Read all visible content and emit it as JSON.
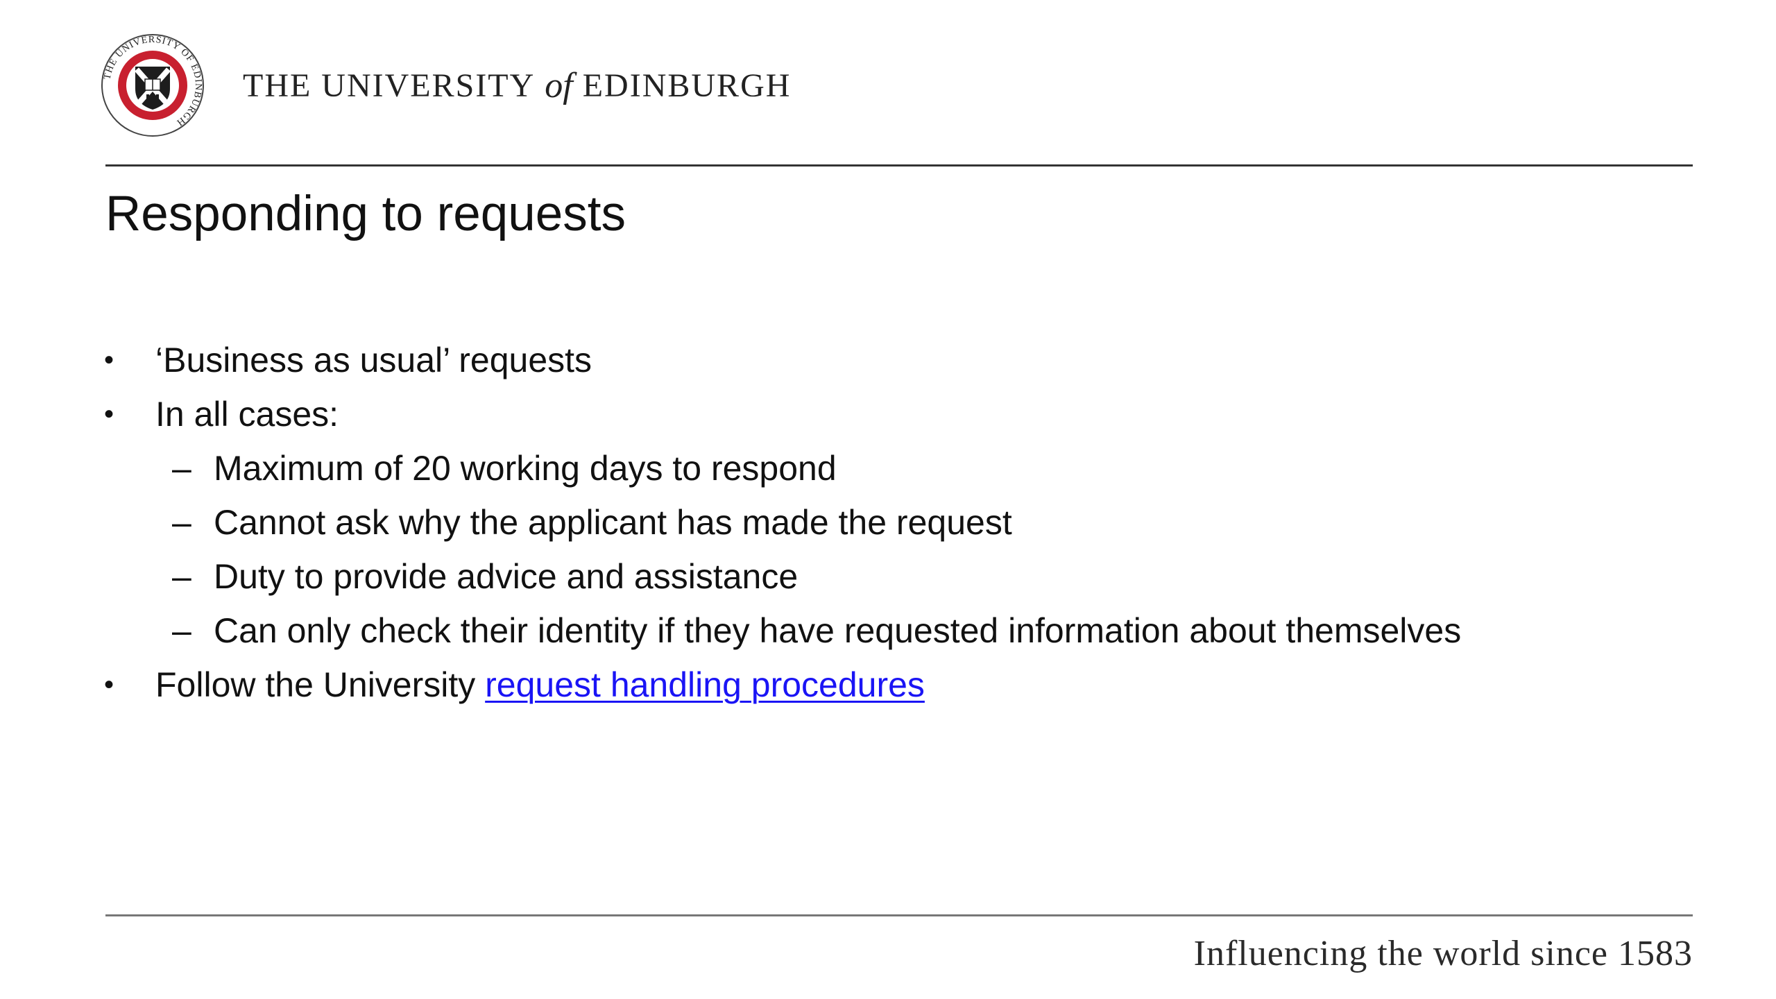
{
  "header": {
    "university_name_part1": "THE UNIVERSITY",
    "university_name_of": "of",
    "university_name_part2": "EDINBURGH",
    "crest_ring_text": "THE UNIVERSITY OF EDINBURGH"
  },
  "slide": {
    "title": "Responding to requests",
    "bullets": [
      {
        "marker": "•",
        "text": "‘Business as usual’ requests"
      },
      {
        "marker": "•",
        "text": "In all cases:"
      },
      {
        "marker": "–",
        "text": "Maximum of 20 working days to respond"
      },
      {
        "marker": "–",
        "text": "Cannot ask why the applicant has made the request"
      },
      {
        "marker": "–",
        "text": "Duty to provide advice and assistance"
      },
      {
        "marker": "–",
        "text": "Can only check their identity if they have requested information about themselves"
      },
      {
        "marker": "•",
        "text": "Follow the University ",
        "link_text": "request handling procedures"
      }
    ]
  },
  "footer": {
    "tagline": "Influencing the world since 1583"
  },
  "colors": {
    "link": "#1a14f5",
    "crest_red": "#c8202f",
    "text": "#111111"
  }
}
